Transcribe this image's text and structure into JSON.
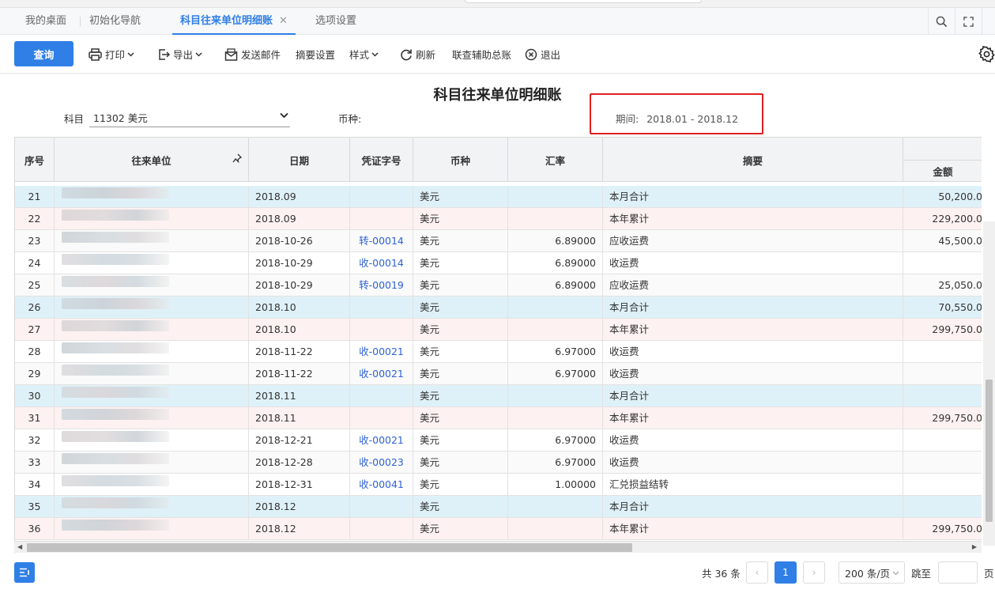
{
  "tabs": [
    {
      "label": "我的桌面",
      "active": false
    },
    {
      "label": "初始化导航",
      "active": false
    },
    {
      "label": "科目往来单位明细账",
      "active": true,
      "closable": true
    },
    {
      "label": "选项设置",
      "active": false
    }
  ],
  "tab_close_glyph": "✕",
  "toolbar": {
    "query": "查询",
    "print": "打印",
    "export": "导出",
    "send_mail": "发送邮件",
    "summary_settings": "摘要设置",
    "style": "样式",
    "refresh": "刷新",
    "linked_ledger": "联查辅助总账",
    "exit": "退出"
  },
  "report": {
    "title": "科目往来单位明细账",
    "subject_label": "科目",
    "subject_value": "11302 美元",
    "currency_label": "币种:",
    "period_label": "期间:",
    "period_value": "2018.01 - 2018.12"
  },
  "columns": {
    "seq": "序号",
    "unit": "往来单位",
    "date": "日期",
    "voucher": "凭证字号",
    "currency": "币种",
    "rate": "汇率",
    "summary": "摘要",
    "amount": "金额"
  },
  "rows": [
    {
      "seq": "21",
      "date": "2018.09",
      "voucher": "",
      "currency": "美元",
      "rate": "",
      "summary": "本月合计",
      "amount": "50,200.0",
      "type": "month"
    },
    {
      "seq": "22",
      "date": "2018.09",
      "voucher": "",
      "currency": "美元",
      "rate": "",
      "summary": "本年累计",
      "amount": "229,200.0",
      "type": "year"
    },
    {
      "seq": "23",
      "date": "2018-10-26",
      "voucher": "转-00014",
      "currency": "美元",
      "rate": "6.89000",
      "summary": "应收运费",
      "amount": "45,500.0",
      "type": "normal"
    },
    {
      "seq": "24",
      "date": "2018-10-29",
      "voucher": "收-00014",
      "currency": "美元",
      "rate": "6.89000",
      "summary": "收运费",
      "amount": "",
      "type": "normal"
    },
    {
      "seq": "25",
      "date": "2018-10-29",
      "voucher": "转-00019",
      "currency": "美元",
      "rate": "6.89000",
      "summary": "应收运费",
      "amount": "25,050.0",
      "type": "normal"
    },
    {
      "seq": "26",
      "date": "2018.10",
      "voucher": "",
      "currency": "美元",
      "rate": "",
      "summary": "本月合计",
      "amount": "70,550.0",
      "type": "month"
    },
    {
      "seq": "27",
      "date": "2018.10",
      "voucher": "",
      "currency": "美元",
      "rate": "",
      "summary": "本年累计",
      "amount": "299,750.0",
      "type": "year"
    },
    {
      "seq": "28",
      "date": "2018-11-22",
      "voucher": "收-00021",
      "currency": "美元",
      "rate": "6.97000",
      "summary": "收运费",
      "amount": "",
      "type": "normal"
    },
    {
      "seq": "29",
      "date": "2018-11-22",
      "voucher": "收-00021",
      "currency": "美元",
      "rate": "6.97000",
      "summary": "收运费",
      "amount": "",
      "type": "normal"
    },
    {
      "seq": "30",
      "date": "2018.11",
      "voucher": "",
      "currency": "美元",
      "rate": "",
      "summary": "本月合计",
      "amount": "",
      "type": "month"
    },
    {
      "seq": "31",
      "date": "2018.11",
      "voucher": "",
      "currency": "美元",
      "rate": "",
      "summary": "本年累计",
      "amount": "299,750.0",
      "type": "year"
    },
    {
      "seq": "32",
      "date": "2018-12-21",
      "voucher": "收-00021",
      "currency": "美元",
      "rate": "6.97000",
      "summary": "收运费",
      "amount": "",
      "type": "normal"
    },
    {
      "seq": "33",
      "date": "2018-12-28",
      "voucher": "收-00023",
      "currency": "美元",
      "rate": "6.97000",
      "summary": "收运费",
      "amount": "",
      "type": "normal"
    },
    {
      "seq": "34",
      "date": "2018-12-31",
      "voucher": "收-00041",
      "currency": "美元",
      "rate": "1.00000",
      "summary": "汇兑损益结转",
      "amount": "",
      "type": "normal"
    },
    {
      "seq": "35",
      "date": "2018.12",
      "voucher": "",
      "currency": "美元",
      "rate": "",
      "summary": "本月合计",
      "amount": "",
      "type": "month"
    },
    {
      "seq": "36",
      "date": "2018.12",
      "voucher": "",
      "currency": "美元",
      "rate": "",
      "summary": "本年累计",
      "amount": "299,750.0",
      "type": "year"
    }
  ],
  "pagination": {
    "total": "共 36 条",
    "prev": "‹",
    "current": "1",
    "next": "›",
    "page_size": "200 条/页",
    "jump_label": "跳至",
    "page_unit": "页"
  },
  "colors": {
    "accent": "#2f7fe6",
    "month_row": "#dff1f8",
    "year_row": "#fdf1f1",
    "highlight_border": "#e02020",
    "voucher_link": "#2f63d6"
  },
  "icons": [
    "search-icon",
    "fullscreen-icon",
    "printer-icon",
    "export-icon",
    "mail-icon",
    "refresh-icon",
    "exit-icon",
    "gear-icon",
    "pin-icon",
    "list-menu-icon"
  ]
}
